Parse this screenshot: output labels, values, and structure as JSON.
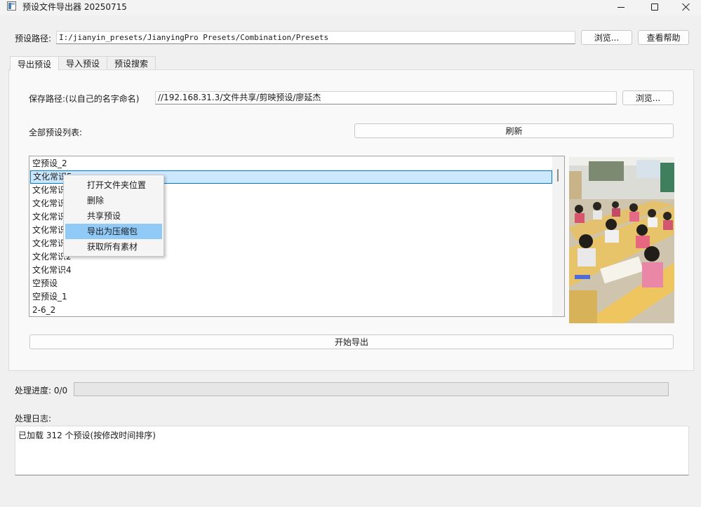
{
  "window": {
    "title": "预设文件导出器 20250715"
  },
  "header": {
    "preset_path_label": "预设路径:",
    "preset_path_value": "I:/jianyin_presets/JianyingPro Presets/Combination/Presets",
    "browse_label": "浏览...",
    "help_label": "查看帮助"
  },
  "tabs": [
    {
      "label": "导出预设",
      "active": true
    },
    {
      "label": "导入预设",
      "active": false
    },
    {
      "label": "预设搜索",
      "active": false
    }
  ],
  "export_tab": {
    "save_path_label": "保存路径:(以自己的名字命名)",
    "save_path_value": "//192.168.31.3/文件共享/剪映预设/廖延杰",
    "browse_label": "浏览...",
    "list_label": "全部预设列表:",
    "refresh_label": "刷新",
    "start_export_label": "开始导出"
  },
  "preset_list": [
    {
      "label": "空预设_2",
      "selected": false
    },
    {
      "label": "文化常识5",
      "selected": true
    },
    {
      "label": "文化常识",
      "selected": false
    },
    {
      "label": "文化常识",
      "selected": false
    },
    {
      "label": "文化常识",
      "selected": false
    },
    {
      "label": "文化常识",
      "selected": false
    },
    {
      "label": "文化常识",
      "selected": false
    },
    {
      "label": "文化常识2",
      "selected": false
    },
    {
      "label": "文化常识4",
      "selected": false
    },
    {
      "label": "空预设",
      "selected": false
    },
    {
      "label": "空预设_1",
      "selected": false
    },
    {
      "label": "2-6_2",
      "selected": false
    }
  ],
  "context_menu": [
    {
      "label": "打开文件夹位置",
      "hover": false
    },
    {
      "label": "删除",
      "hover": false
    },
    {
      "label": "共享预设",
      "hover": false
    },
    {
      "label": "导出为压缩包",
      "hover": true
    },
    {
      "label": "获取所有素材",
      "hover": false
    }
  ],
  "progress": {
    "label": "处理进度: 0/0",
    "value": 0
  },
  "log": {
    "label": "处理日志:",
    "lines": [
      "已加载 312 个预设(按修改时间排序)"
    ]
  },
  "colors": {
    "selection": "#cce8ff",
    "selection_border": "#0078d7",
    "menu_hover": "#91c9f7"
  }
}
